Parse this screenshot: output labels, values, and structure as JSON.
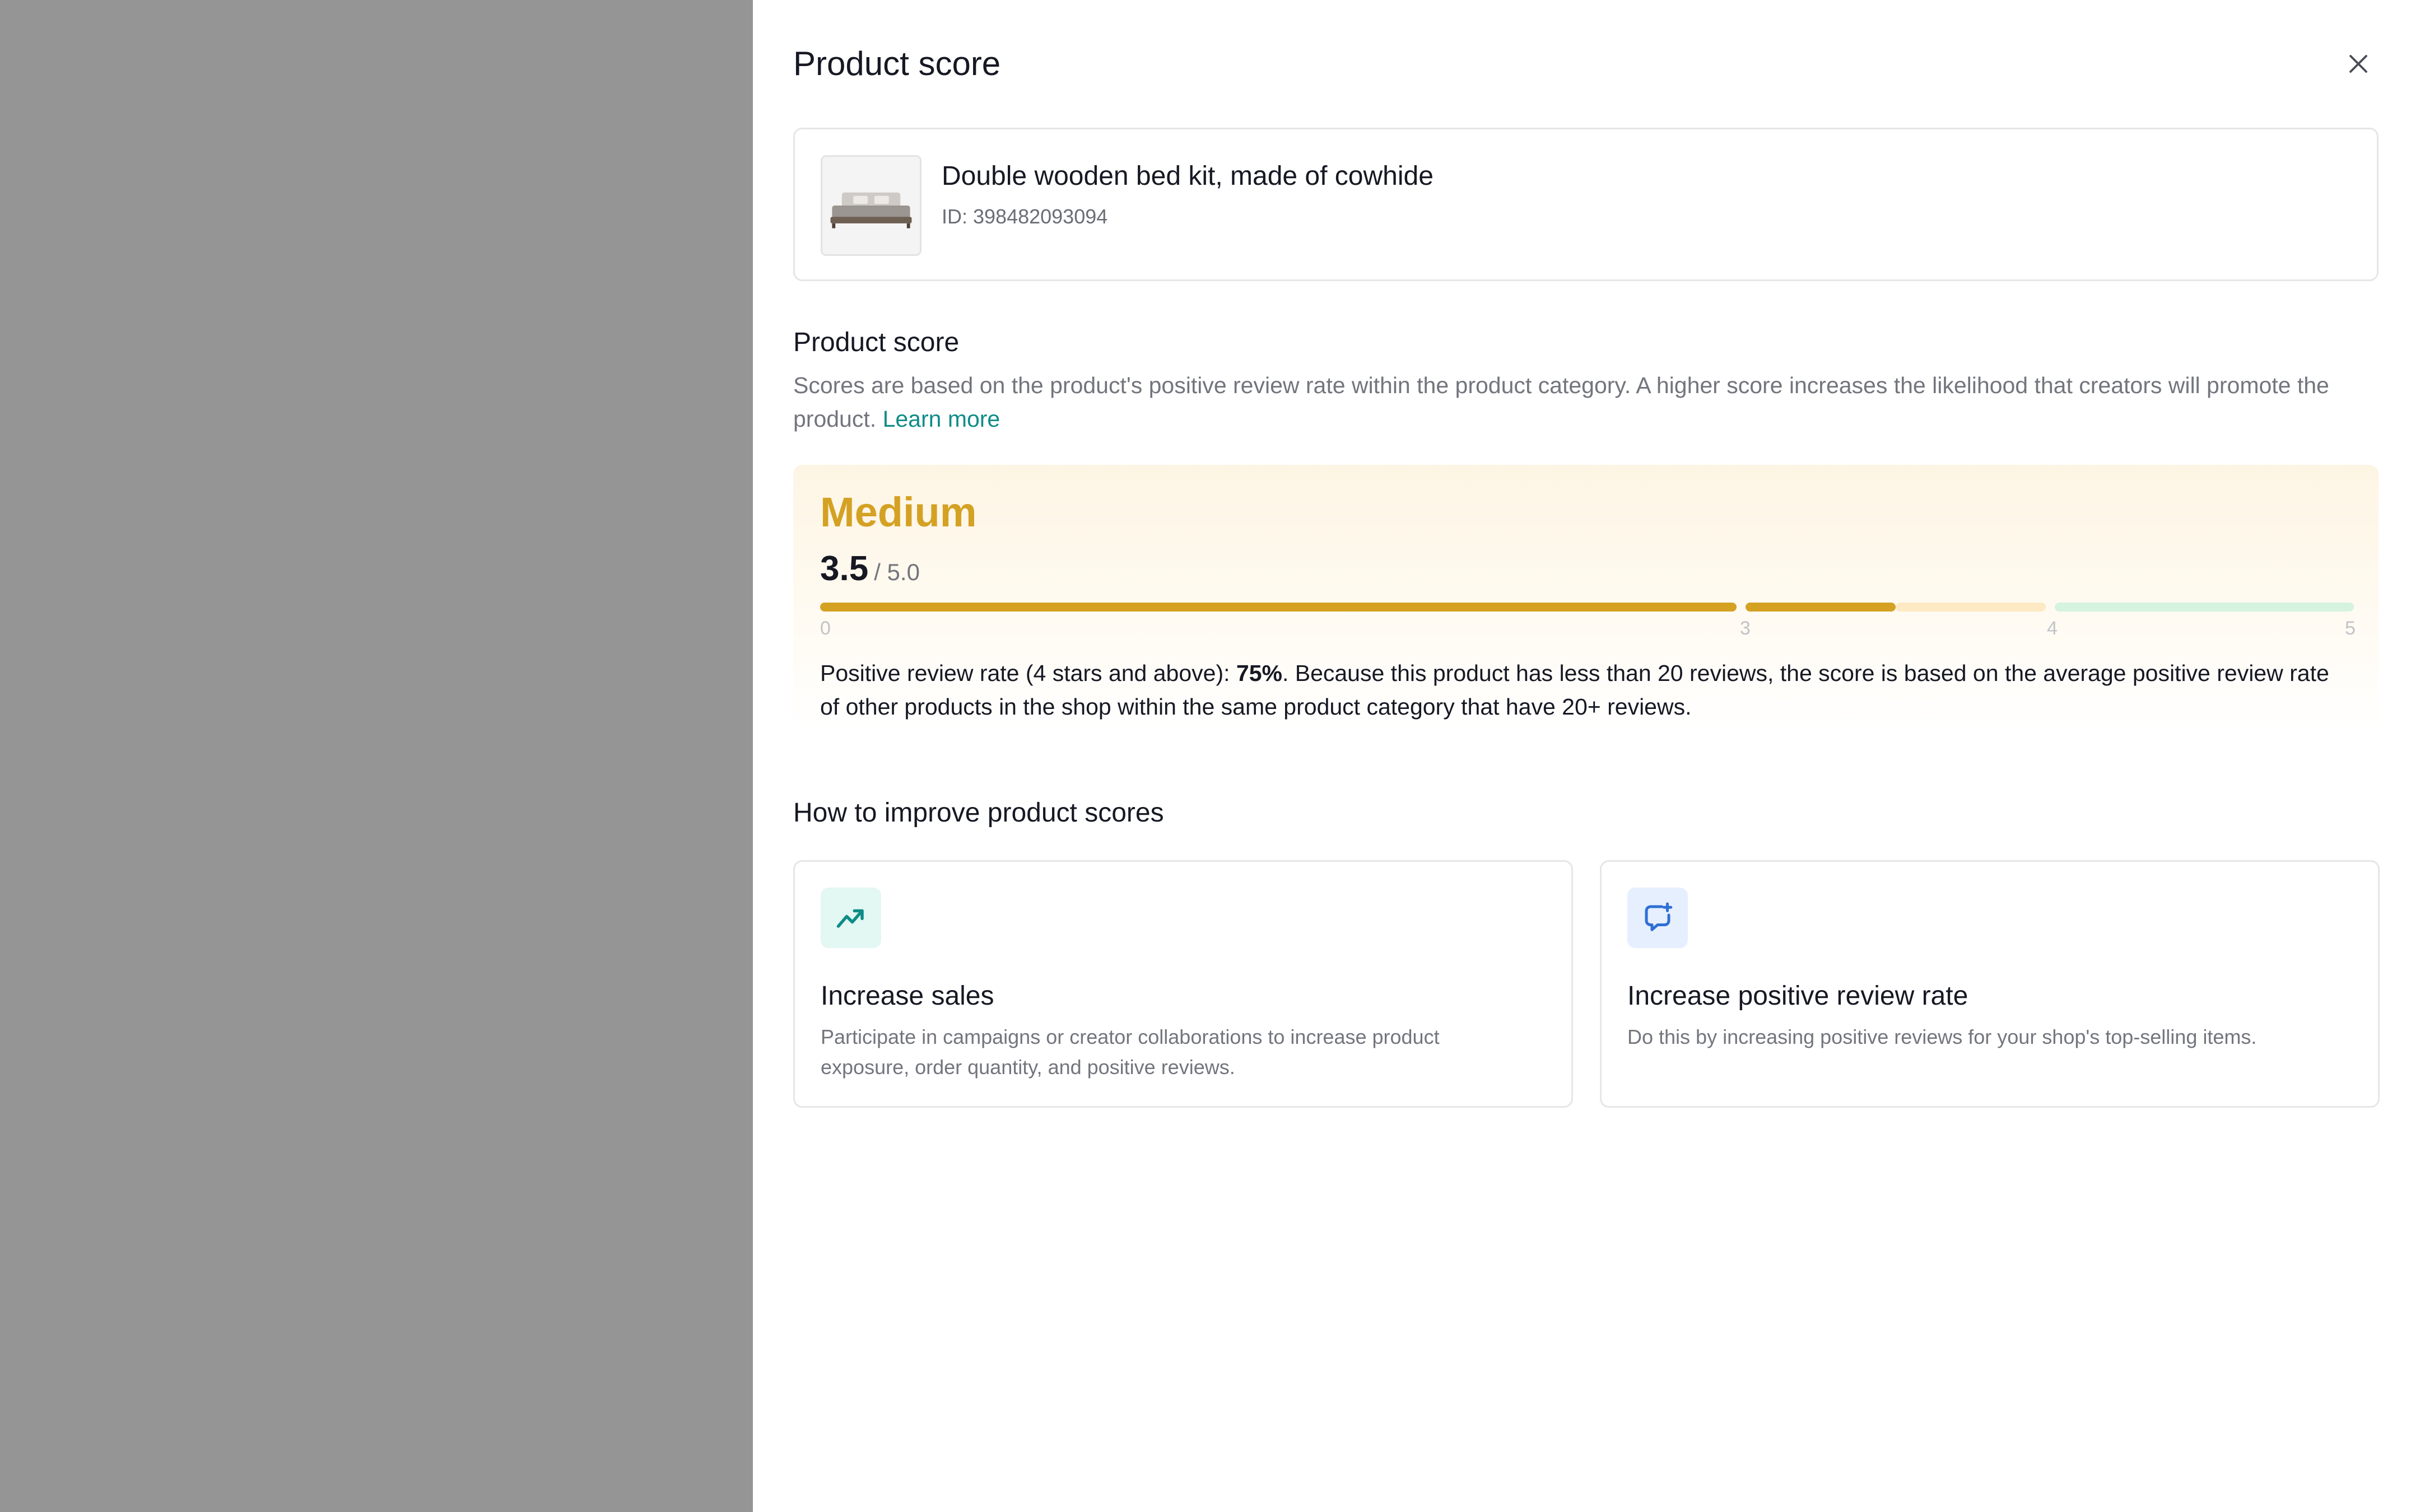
{
  "drawer": {
    "title": "Product score"
  },
  "product": {
    "name": "Double wooden bed kit, made of cowhide",
    "id_text": "ID: 398482093094"
  },
  "score_section": {
    "title": "Product score",
    "description": "Scores are based on the product's positive review rate within the product category. A higher score increases the likelihood that creators will promote the product.",
    "learn_more": "Learn more"
  },
  "score": {
    "level": "Medium",
    "value": "3.5",
    "max": "/ 5.0",
    "value_numeric": 3.5,
    "max_numeric": 5.0,
    "ticks": [
      "0",
      "3",
      "4",
      "5"
    ],
    "explain_prefix": "Positive review rate (4 stars and above): ",
    "explain_rate": "75%",
    "explain_suffix": ". Because this product has less than 20 reviews, the score is based on the average positive review rate of other products in the shop within the same product category that have 20+ reviews.",
    "colors": {
      "level": "#d4a123",
      "fill": "#d4a123",
      "medium_track": "#fde9c4",
      "high_track": "#d5f3de"
    }
  },
  "improve": {
    "title": "How to improve product scores",
    "cards": [
      {
        "title": "Increase sales",
        "description": "Participate in campaigns or creator collaborations to increase product exposure, order quantity, and positive reviews.",
        "icon": "trending-up-icon",
        "icon_color": "#0e8c87",
        "icon_bg": "#e3f7f3"
      },
      {
        "title": "Increase positive review rate",
        "description": "Do this by increasing positive reviews for your shop's top-selling items.",
        "icon": "chat-plus-icon",
        "icon_color": "#2f6fd6",
        "icon_bg": "#e6effd"
      }
    ]
  }
}
